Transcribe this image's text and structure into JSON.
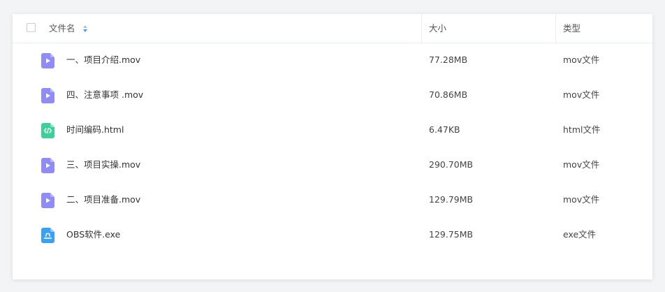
{
  "table": {
    "columns": {
      "name": "文件名",
      "size": "大小",
      "type": "类型"
    },
    "rows": [
      {
        "name": "一、项目介绍.mov",
        "size": "77.28MB",
        "type": "mov文件",
        "icon": "video-file-icon"
      },
      {
        "name": "四、注意事项 .mov",
        "size": "70.86MB",
        "type": "mov文件",
        "icon": "video-file-icon"
      },
      {
        "name": "时间编码.html",
        "size": "6.47KB",
        "type": "html文件",
        "icon": "code-file-icon"
      },
      {
        "name": "三、项目实操.mov",
        "size": "290.70MB",
        "type": "mov文件",
        "icon": "video-file-icon"
      },
      {
        "name": "二、项目准备.mov",
        "size": "129.79MB",
        "type": "mov文件",
        "icon": "video-file-icon"
      },
      {
        "name": "OBS软件.exe",
        "size": "129.75MB",
        "type": "exe文件",
        "icon": "exe-file-icon"
      }
    ]
  },
  "colors": {
    "video_icon": "#8f8cf5",
    "code_icon": "#3ecf9b",
    "exe_icon": "#3aa1f2",
    "sort_up": "#b8bcc4",
    "sort_down": "#3aa1f2"
  }
}
